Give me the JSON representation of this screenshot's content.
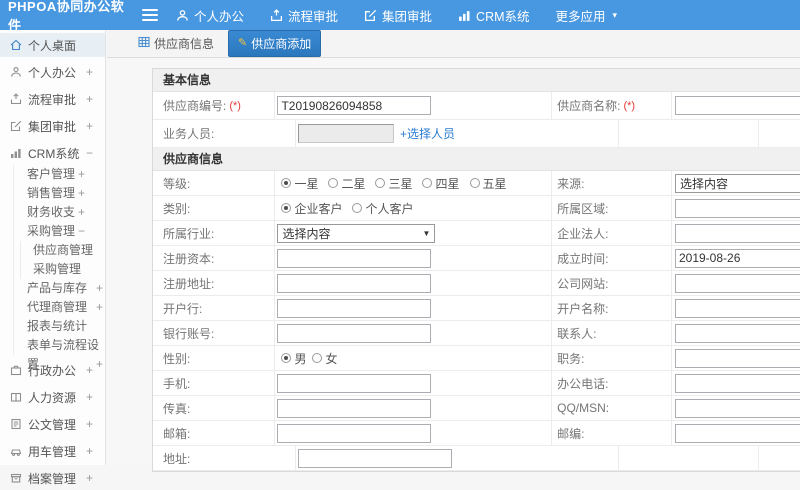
{
  "colors": {
    "topbar_blue": "#4797e1",
    "active_tab_blue": "#2f80c9",
    "link_blue": "#2b7cd1",
    "required_red": "#e53935",
    "sidebar_active_bg": "#e7eef4"
  },
  "topbar": {
    "logo": "PHPOA协同办公软件",
    "menu": [
      {
        "label": "个人办公",
        "icon": "user-icon"
      },
      {
        "label": "流程审批",
        "icon": "upload-icon"
      },
      {
        "label": "集团审批",
        "icon": "edit-icon"
      },
      {
        "label": "CRM系统",
        "icon": "chart-icon"
      },
      {
        "label": "更多应用",
        "icon": "caret-down-icon",
        "caret": "▾"
      }
    ]
  },
  "tabs": [
    {
      "label": "供应商信息"
    },
    {
      "label": "供应商添加"
    }
  ],
  "sidebar": {
    "top": [
      {
        "label": "个人桌面",
        "icon": "home-icon",
        "expand": ""
      },
      {
        "label": "个人办公",
        "icon": "user-icon",
        "expand": "+"
      },
      {
        "label": "流程审批",
        "icon": "upload-icon",
        "expand": "+"
      },
      {
        "label": "集团审批",
        "icon": "edit-icon",
        "expand": "+"
      },
      {
        "label": "CRM系统",
        "icon": "chart-icon",
        "expand": "−"
      }
    ],
    "crm": [
      {
        "label": "客户管理",
        "expand": "+"
      },
      {
        "label": "销售管理",
        "expand": "+"
      },
      {
        "label": "财务收支",
        "expand": "+"
      },
      {
        "label": "采购管理",
        "expand": "−"
      }
    ],
    "purchase": [
      {
        "label": "供应商管理"
      },
      {
        "label": "采购管理"
      }
    ],
    "crm2": [
      {
        "label": "产品与库存",
        "expand": "+"
      },
      {
        "label": "代理商管理",
        "expand": "+"
      },
      {
        "label": "报表与统计",
        "expand": ""
      },
      {
        "label": "表单与流程设置",
        "expand": "+"
      }
    ],
    "bottom": [
      {
        "label": "行政办公",
        "icon": "briefcase-icon",
        "expand": "+"
      },
      {
        "label": "人力资源",
        "icon": "people-icon",
        "expand": "+"
      },
      {
        "label": "公文管理",
        "icon": "document-icon",
        "expand": "+"
      },
      {
        "label": "用车管理",
        "icon": "car-icon",
        "expand": "+"
      },
      {
        "label": "档案管理",
        "icon": "archive-icon",
        "expand": "+"
      }
    ]
  },
  "form": {
    "basic": {
      "title": "基本信息",
      "supplier_no": {
        "label": "供应商编号:",
        "required": "(*)",
        "value": "T20190826094858"
      },
      "supplier_name": {
        "label": "供应商名称:",
        "required": "(*)",
        "value": ""
      },
      "staff": {
        "label": "业务人员:",
        "value": "",
        "link": "+选择人员"
      }
    },
    "info": {
      "title": "供应商信息",
      "level": {
        "label": "等级:",
        "options": [
          "一星",
          "二星",
          "三星",
          "四星",
          "五星"
        ],
        "selected": 0
      },
      "source": {
        "label": "来源:",
        "value": "选择内容"
      },
      "category": {
        "label": "类别:",
        "options": [
          "企业客户",
          "个人客户"
        ],
        "selected": 0
      },
      "region": {
        "label": "所属区域:",
        "value": ""
      },
      "industry": {
        "label": "所属行业:",
        "value": "选择内容"
      },
      "legal_person": {
        "label": "企业法人:",
        "value": ""
      },
      "reg_capital": {
        "label": "注册资本:",
        "value": ""
      },
      "founded": {
        "label": "成立时间:",
        "value": "2019-08-26"
      },
      "reg_address": {
        "label": "注册地址:",
        "value": ""
      },
      "website": {
        "label": "公司网站:",
        "value": ""
      },
      "bank": {
        "label": "开户行:",
        "value": ""
      },
      "account_name": {
        "label": "开户名称:",
        "value": ""
      },
      "bank_account": {
        "label": "银行账号:",
        "value": ""
      },
      "contact": {
        "label": "联系人:",
        "value": ""
      },
      "gender": {
        "label": "性别:",
        "options": [
          "男",
          "女"
        ],
        "selected": 0
      },
      "position": {
        "label": "职务:",
        "value": ""
      },
      "mobile": {
        "label": "手机:",
        "value": ""
      },
      "office_phone": {
        "label": "办公电话:",
        "value": ""
      },
      "fax": {
        "label": "传真:",
        "value": ""
      },
      "qq": {
        "label": "QQ/MSN:",
        "value": ""
      },
      "email": {
        "label": "邮箱:",
        "value": ""
      },
      "zip": {
        "label": "邮编:",
        "value": ""
      },
      "address": {
        "label": "地址:",
        "value": ""
      }
    }
  }
}
